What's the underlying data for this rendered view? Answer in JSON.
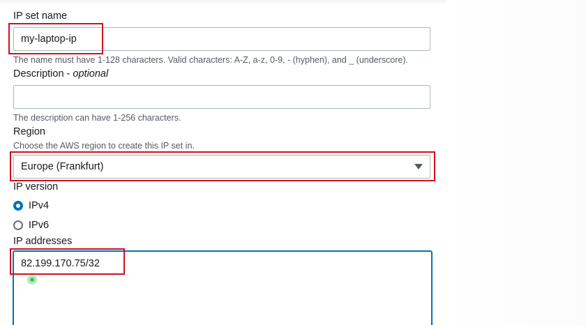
{
  "ip_set_name": {
    "label": "IP set name",
    "value": "my-laptop-ip",
    "hint": "The name must have 1-128 characters. Valid characters: A-Z, a-z, 0-9, - (hyphen), and _ (underscore)."
  },
  "description": {
    "label": "Description",
    "label_suffix": "optional",
    "label_separator": " - ",
    "value": "",
    "hint": "The description can have 1-256 characters."
  },
  "region": {
    "label": "Region",
    "hint": "Choose the AWS region to create this IP set in.",
    "selected": "Europe (Frankfurt)"
  },
  "ip_version": {
    "label": "IP version",
    "options": [
      {
        "label": "IPv4",
        "checked": true
      },
      {
        "label": "IPv6",
        "checked": false
      }
    ]
  },
  "ip_addresses": {
    "label": "IP addresses",
    "value": "82.199.170.75/32"
  },
  "colors": {
    "accent": "#0073bb",
    "highlight": "#d0101b",
    "hint_text": "#545b64",
    "border": "#aab7b8"
  }
}
